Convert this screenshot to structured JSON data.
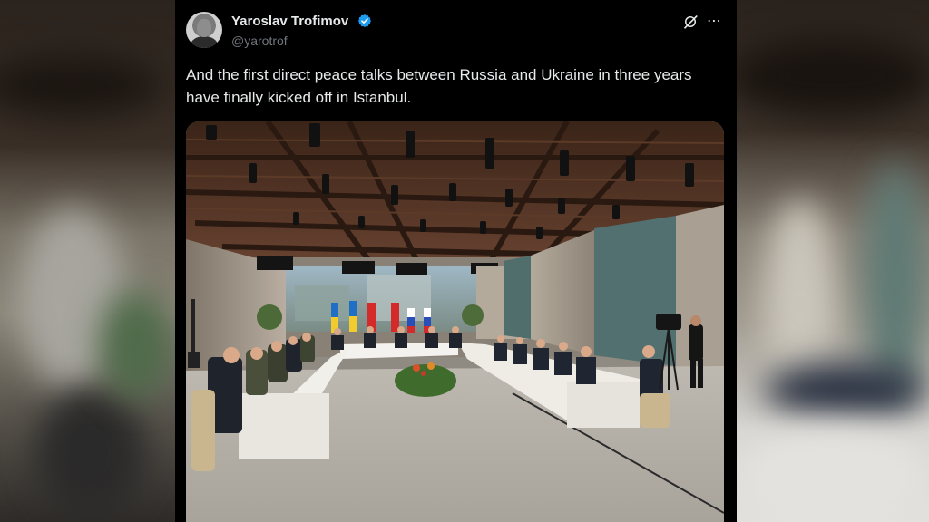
{
  "tweet": {
    "author_name": "Yaroslav Trofimov",
    "author_handle": "@yarotrof",
    "text": "And the first direct peace talks between Russia and Ukraine in three years have finally kicked off in Istanbul."
  },
  "icons": {
    "verified": "verified-badge-icon",
    "grok": "grok-icon",
    "more": "more-options-icon"
  },
  "colors": {
    "verified_blue": "#1d9bf0",
    "background": "#000000",
    "text_primary": "#e7e9ea",
    "text_secondary": "#71767b"
  }
}
